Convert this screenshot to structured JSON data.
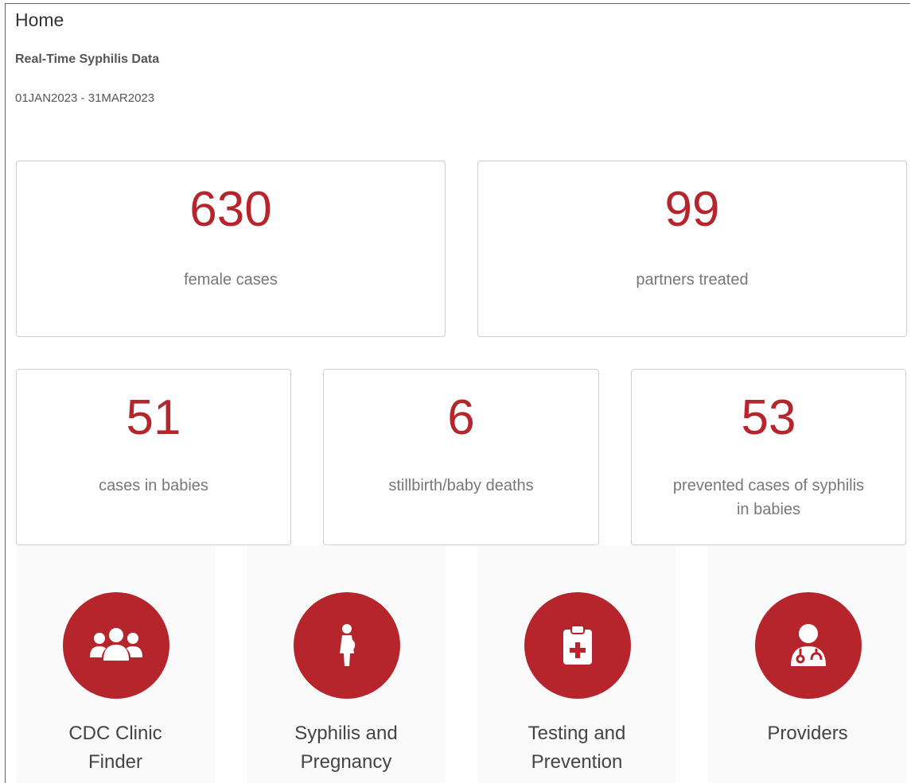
{
  "header": {
    "breadcrumb": "Home",
    "subtitle": "Real-Time Syphilis Data",
    "date_range": "01JAN2023 - 31MAR2023"
  },
  "stats": [
    {
      "value": "630",
      "label": "female cases"
    },
    {
      "value": "99",
      "label": "partners treated"
    },
    {
      "value": "51",
      "label": "cases in babies"
    },
    {
      "value": "6",
      "label": "stillbirth/baby deaths"
    },
    {
      "value": "53",
      "label": "prevented cases of syphilis in babies"
    }
  ],
  "links": [
    {
      "label": "CDC Clinic Finder",
      "icon": "users-group-icon"
    },
    {
      "label": "Syphilis and Pregnancy",
      "icon": "pregnant-woman-icon"
    },
    {
      "label": "Testing and Prevention",
      "icon": "clipboard-medical-icon"
    },
    {
      "label": "Providers",
      "icon": "doctor-icon"
    }
  ],
  "colors": {
    "accent": "#b5252b",
    "tile_bg": "#fafafa",
    "border": "#cfcfcf"
  }
}
